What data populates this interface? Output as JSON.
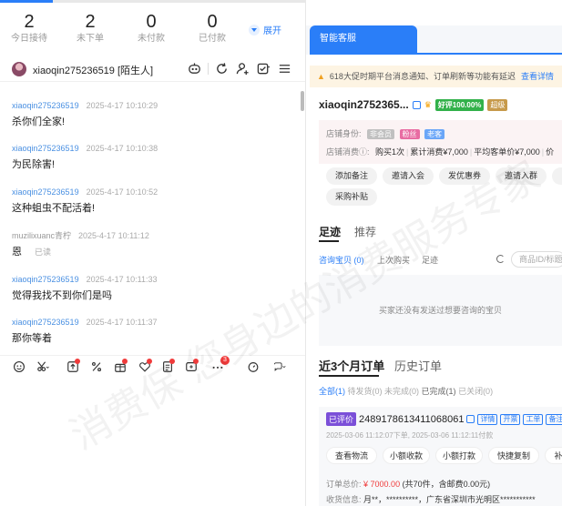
{
  "stats": [
    {
      "num": "2",
      "label": "今日接待"
    },
    {
      "num": "2",
      "label": "未下单"
    },
    {
      "num": "0",
      "label": "未付款"
    },
    {
      "num": "0",
      "label": "已付款"
    }
  ],
  "expand_label": "展开",
  "chat": {
    "contact_name": "xiaoqin275236519 [陌生人]",
    "messages": [
      {
        "nick": "xiaoqin275236519",
        "time": "2025-4-17 10:10:29",
        "text": "杀你们全家!"
      },
      {
        "nick": "xiaoqin275236519",
        "time": "2025-4-17 10:10:38",
        "text": "为民除害!"
      },
      {
        "nick": "xiaoqin275236519",
        "time": "2025-4-17 10:10:52",
        "text": "这种蛆虫不配活着!"
      },
      {
        "nick": "muzilixuanc青柠",
        "time": "2025-4-17 10:11:12",
        "text": "恩",
        "read": "已读"
      },
      {
        "nick": "xiaoqin275236519",
        "time": "2025-4-17 10:11:33",
        "text": "觉得我找不到你们是吗"
      },
      {
        "nick": "xiaoqin275236519",
        "time": "2025-4-17 10:11:37",
        "text": "那你等着"
      }
    ],
    "toolbar_badge": "3"
  },
  "right": {
    "tab_label": "智能客服",
    "notice_text": "618大促时期平台消息通知、订单刷新等功能有延迟",
    "notice_link": "查看详情",
    "customer_name": "xiaoqin2752365...",
    "rating_badge": "好评100.00%",
    "level_badge": "超级",
    "identity_label": "店铺身份:",
    "identity_tags": [
      "非会员",
      "粉丝",
      "老客"
    ],
    "consume_label": "店铺消费ⓘ:",
    "consume_values": [
      "购买1次",
      "累计消费¥7,000",
      "平均客单价¥7,000",
      "价"
    ],
    "actions": [
      "添加备注",
      "邀请入会",
      "发优惠券",
      "邀请入群",
      "发送",
      "采购补贴"
    ],
    "footprint_tabs": [
      "足迹",
      "推荐"
    ],
    "footprint_sub": [
      "咨询宝贝 (0)",
      "上次购买",
      "足迹"
    ],
    "search_placeholder": "商品ID/标题",
    "empty_text": "买家还没有发送过想要咨询的宝贝",
    "order_tabs": [
      "近3个月订单",
      "历史订单"
    ],
    "order_filters": {
      "all": "全部(1)",
      "items": [
        "待发货(0)",
        "未完成(0)",
        "已完成(1)",
        "已关闭(0)"
      ]
    },
    "order": {
      "status": "已评价",
      "id": "2489178613411068061",
      "mini_tags": [
        "详情",
        "开票",
        "工单",
        "备注"
      ],
      "time": "2025-03-06 11:12:07下单, 2025-03-06 11:12:11付款",
      "buttons": [
        "查看物流",
        "小额收款",
        "小额打款",
        "快捷复制",
        "补"
      ],
      "total_label": "订单总价:",
      "total_price": "¥ 7000.00",
      "total_detail": "(共70件，含邮费0.00元)",
      "addr_label": "收货信息:",
      "addr_value": "月**，**********，广东省深圳市光明区***********"
    }
  },
  "watermark": "消费保 您身边的消费服务专家"
}
